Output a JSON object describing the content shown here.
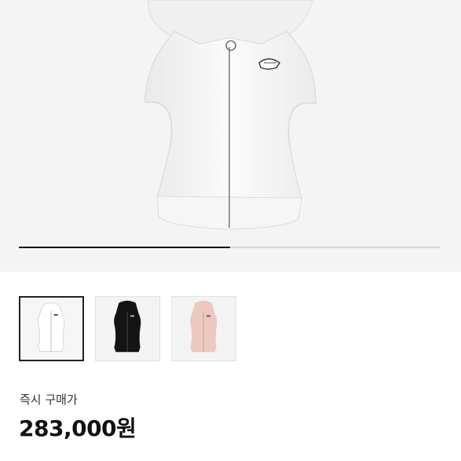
{
  "product": {
    "image_name": "white-zip-hoodie-vest",
    "carousel_progress": 0.5,
    "thumbnails": [
      {
        "name": "white-vest-thumbnail",
        "color": "#f6f6f6",
        "selected": true
      },
      {
        "name": "black-vest-thumbnail",
        "color": "#111111",
        "selected": false
      },
      {
        "name": "pink-vest-thumbnail",
        "color": "#e9c9bf",
        "selected": false
      }
    ]
  },
  "pricing": {
    "label": "즉시 구매가",
    "price": "283,000원"
  },
  "colors": {
    "accent": "#111111",
    "track": "#d6d6d6",
    "hero_bg": "#f4f4f4"
  }
}
